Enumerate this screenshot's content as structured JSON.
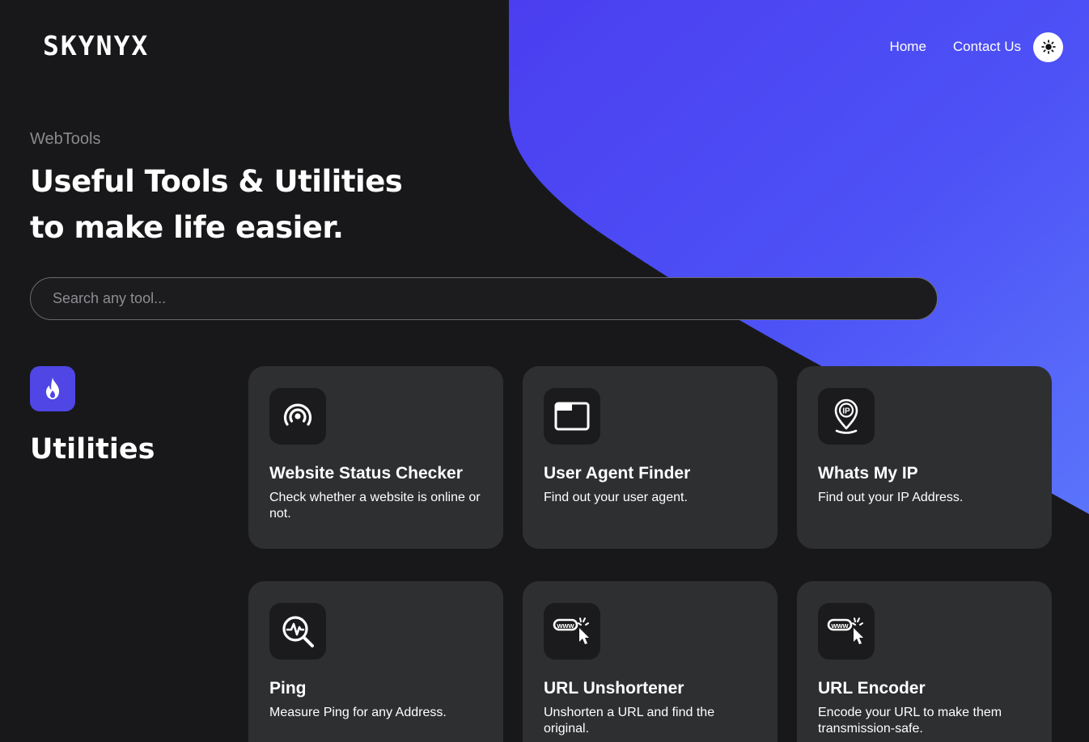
{
  "brand": {
    "logo_text": "SKYNYX"
  },
  "nav": {
    "home": "Home",
    "contact": "Contact Us",
    "theme_toggle_icon": "sun-icon"
  },
  "hero": {
    "eyebrow": "WebTools",
    "headline_line1": "Useful Tools & Utilities",
    "headline_line2": "to make life easier."
  },
  "search": {
    "placeholder": "Search any tool..."
  },
  "section": {
    "icon": "fire-icon",
    "title": "Utilities"
  },
  "tools": [
    {
      "title": "Website Status Checker",
      "description": "Check whether a website is online or not.",
      "icon": "broadcast-icon"
    },
    {
      "title": "User Agent Finder",
      "description": "Find out your user agent.",
      "icon": "browser-window-icon"
    },
    {
      "title": "Whats My IP",
      "description": "Find out your IP Address.",
      "icon": "ip-location-icon"
    },
    {
      "title": "Ping",
      "description": "Measure Ping for any Address.",
      "icon": "ping-search-icon"
    },
    {
      "title": "URL Unshortener",
      "description": "Unshorten a URL and find the original.",
      "icon": "url-click-icon"
    },
    {
      "title": "URL Encoder",
      "description": "Encode your URL to make them transmission-safe.",
      "icon": "url-click-icon"
    }
  ],
  "colors": {
    "background": "#18181a",
    "accent": "#4f46e5",
    "card": "#2e2f31",
    "icon_tile": "#1b1b1d"
  }
}
